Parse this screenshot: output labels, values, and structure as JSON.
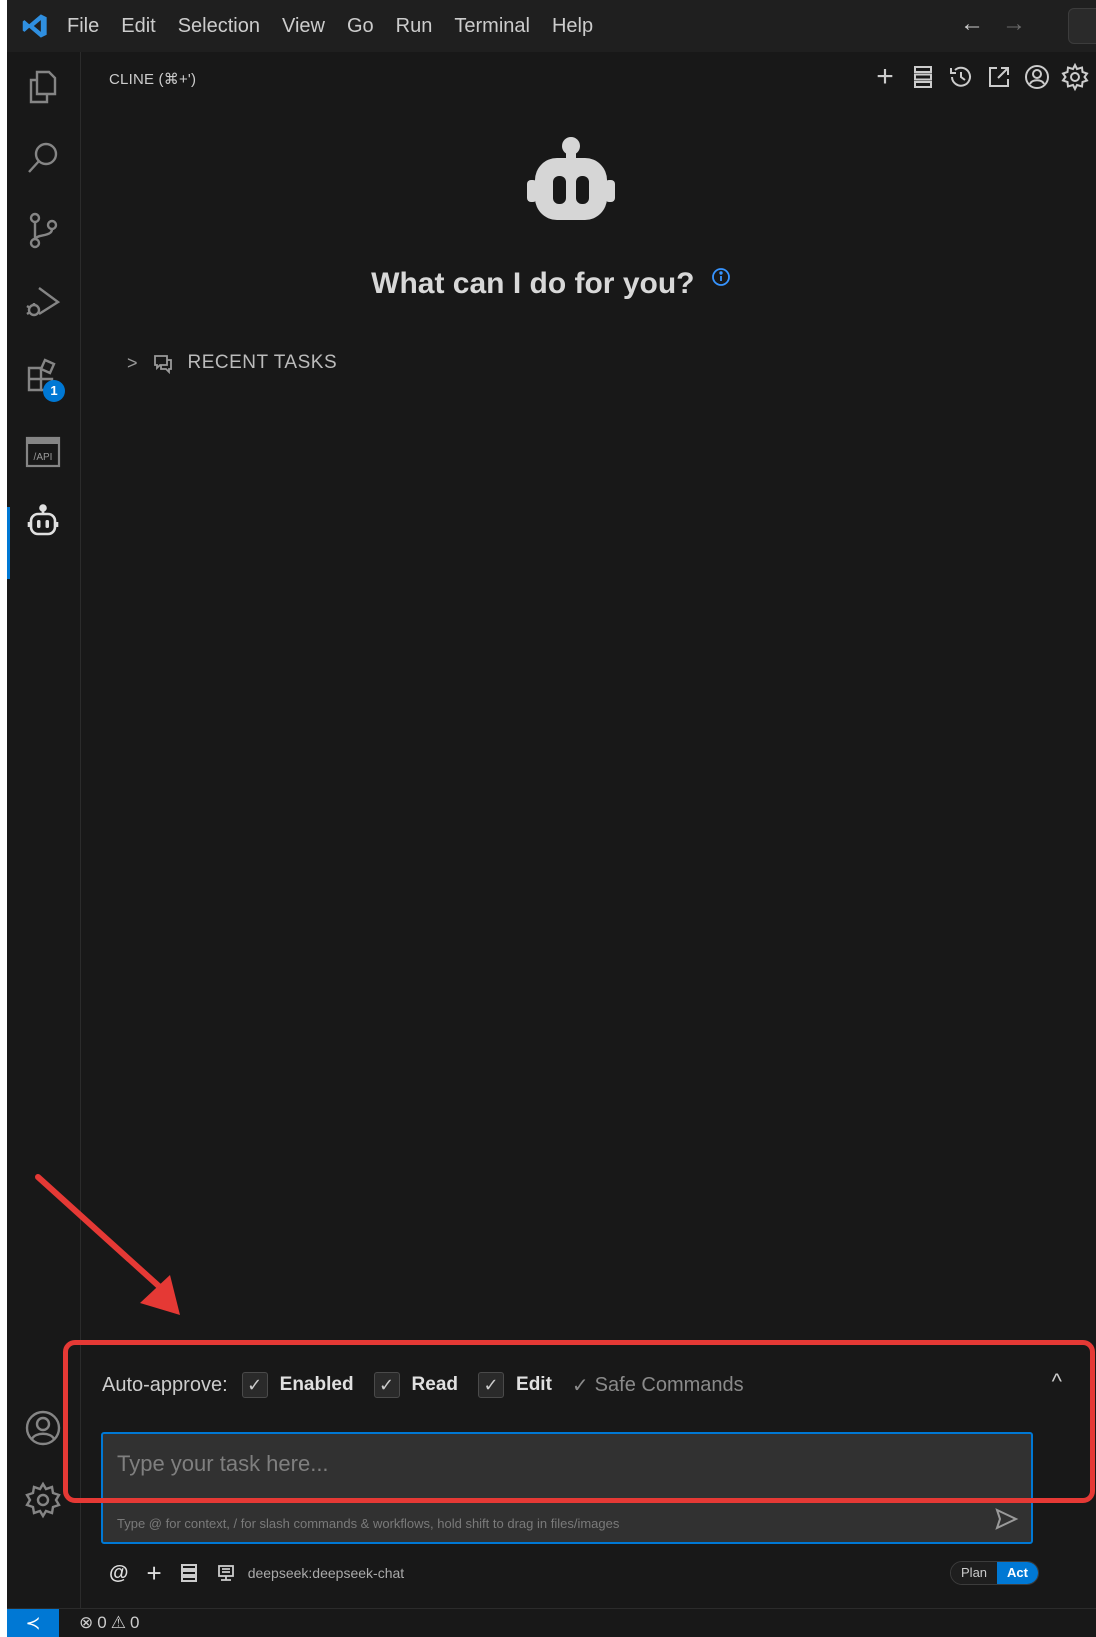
{
  "menu": {
    "items": [
      "File",
      "Edit",
      "Selection",
      "View",
      "Go",
      "Run",
      "Terminal",
      "Help"
    ],
    "back_glyph": "←",
    "forward_glyph": "→"
  },
  "activity_bar": {
    "icons": [
      "explorer-icon",
      "search-icon",
      "source-control-icon",
      "run-debug-icon",
      "extensions-icon",
      "api-icon",
      "cline-robot-icon"
    ],
    "extensions_badge": "1",
    "api_label": "/API"
  },
  "panel": {
    "title": "CLINE (⌘+')",
    "actions": [
      "plus-icon",
      "mcp-server-icon",
      "history-icon",
      "popout-icon",
      "account-icon",
      "settings-icon"
    ],
    "plus_glyph": "+",
    "hero_title": "What can I do for you?",
    "recent_tasks_label": "RECENT TASKS"
  },
  "auto_approve": {
    "label": "Auto-approve:",
    "check_glyph": "✓",
    "options": [
      {
        "label": "Enabled",
        "checked": true
      },
      {
        "label": "Read",
        "checked": true
      },
      {
        "label": "Edit",
        "checked": true
      }
    ],
    "safe_commands": "Safe Commands",
    "collapse_glyph": "^"
  },
  "task_input": {
    "placeholder": "Type your task here...",
    "hint": "Type @ for context, / for slash commands & workflows, hold shift to drag in files/images"
  },
  "bottom_bar": {
    "at_glyph": "@",
    "plus_glyph": "+",
    "model": "deepseek:deepseek-chat",
    "mode_plan": "Plan",
    "mode_act": "Act",
    "active_mode": "Act"
  },
  "status_bar": {
    "remote_glyph": "≺",
    "errors": "0",
    "warnings": "0",
    "error_glyph": "⊗",
    "warning_glyph": "⚠"
  },
  "colors": {
    "accent": "#0078d4",
    "annotation": "#e53935",
    "background": "#181818"
  }
}
